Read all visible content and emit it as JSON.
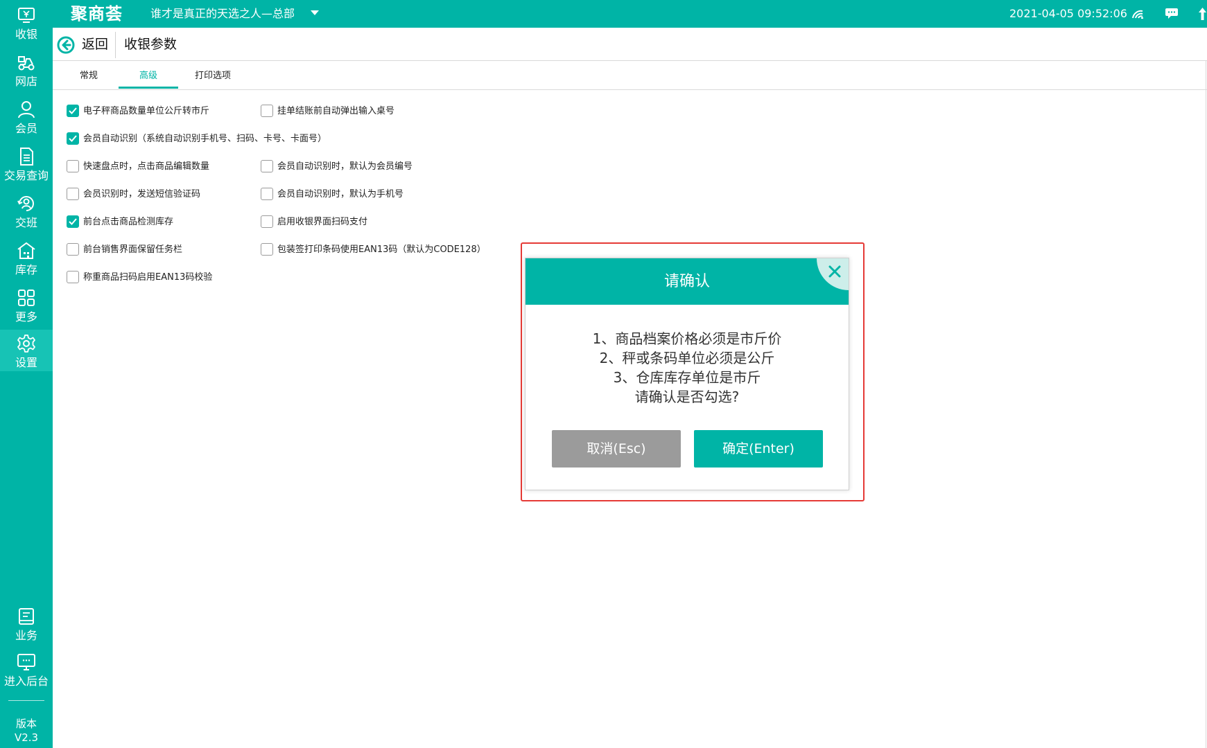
{
  "app": {
    "logo": "聚商荟",
    "store_name": "谁才是真正的天选之人—总部",
    "datetime": "2021-04-05 09:52:06",
    "icons": [
      "wifi-icon",
      "message-icon",
      "upload-icon"
    ]
  },
  "sidebar": {
    "items": [
      {
        "label": "收银",
        "icon": "cashier-icon"
      },
      {
        "label": "网店",
        "icon": "delivery-icon"
      },
      {
        "label": "会员",
        "icon": "member-icon"
      },
      {
        "label": "交易查询",
        "icon": "document-icon"
      },
      {
        "label": "交班",
        "icon": "shift-icon"
      },
      {
        "label": "库存",
        "icon": "warehouse-icon"
      },
      {
        "label": "更多",
        "icon": "grid-icon"
      },
      {
        "label": "设置",
        "icon": "gear-icon",
        "active": true
      },
      {
        "label": "业务",
        "icon": "book-icon"
      },
      {
        "label": "进入后台",
        "icon": "monitor-icon"
      }
    ],
    "version_label": "版本",
    "version": "V2.3"
  },
  "header": {
    "back_label": "返回",
    "title": "收银参数"
  },
  "tabs": [
    {
      "label": "常规",
      "active": false
    },
    {
      "label": "高级",
      "active": true
    },
    {
      "label": "打印选项",
      "active": false
    }
  ],
  "options": [
    {
      "label": "电子秤商品数量单位公斤转市斤",
      "checked": true
    },
    {
      "label": "挂单结账前自动弹出输入桌号",
      "checked": false
    },
    {
      "label": "会员自动识别（系统自动识别手机号、扫码、卡号、卡面号）",
      "checked": true
    },
    {
      "label": "快速盘点时，点击商品编辑数量",
      "checked": false
    },
    {
      "label": "会员自动识别时，默认为会员编号",
      "checked": false
    },
    {
      "label": "会员识别时，发送短信验证码",
      "checked": false
    },
    {
      "label": "会员自动识别时，默认为手机号",
      "checked": false
    },
    {
      "label": "前台点击商品检测库存",
      "checked": true
    },
    {
      "label": "启用收银界面扫码支付",
      "checked": false
    },
    {
      "label": "前台销售界面保留任务栏",
      "checked": false
    },
    {
      "label": "包装签打印条码使用EAN13码（默认为CODE128）",
      "checked": false
    },
    {
      "label": "称重商品扫码启用EAN13码校验",
      "checked": false
    }
  ],
  "dialog": {
    "title": "请确认",
    "lines": [
      "1、商品档案价格必须是市斤价",
      "2、秤或条码单位必须是公斤",
      "3、仓库库存单位是市斤",
      "请确认是否勾选?"
    ],
    "cancel_label": "取消(Esc)",
    "ok_label": "确定(Enter)"
  },
  "colors": {
    "primary": "#00b4a6",
    "highlight": "#e53935",
    "cancel": "#9b9b9b"
  }
}
